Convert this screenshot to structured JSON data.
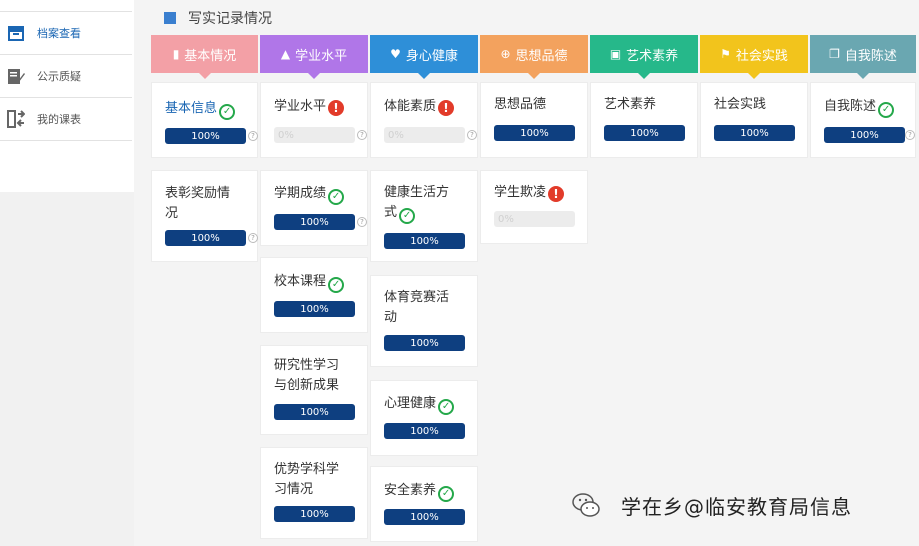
{
  "sidebar": {
    "items": [
      {
        "label": "档案查看",
        "icon": "archive-icon",
        "active": true
      },
      {
        "label": "公示质疑",
        "icon": "edit-icon",
        "active": false
      },
      {
        "label": "我的课表",
        "icon": "schedule-icon",
        "active": false
      }
    ]
  },
  "section": {
    "title": "写实记录情况"
  },
  "colors": {
    "basic": "#f3a0a6",
    "academic": "#b076e8",
    "health": "#2e8fd8",
    "moral": "#f3a25e",
    "art": "#26b88a",
    "social": "#f2c41c",
    "self": "#6aa7b1",
    "progress": "#0e3f80",
    "ok": "#24a84a",
    "warn": "#e23b2a",
    "link": "#1a66b3"
  },
  "tabs": [
    {
      "label": "基本情况",
      "icon": "document-icon"
    },
    {
      "label": "学业水平",
      "icon": "graduation-cap-icon"
    },
    {
      "label": "身心健康",
      "icon": "heart-icon"
    },
    {
      "label": "思想品德",
      "icon": "plus-circle-icon"
    },
    {
      "label": "艺术素养",
      "icon": "picture-icon"
    },
    {
      "label": "社会实践",
      "icon": "flag-icon"
    },
    {
      "label": "自我陈述",
      "icon": "copy-icon"
    }
  ],
  "cards": {
    "basic_info": {
      "title": "基本信息",
      "progress": "100%",
      "status": "ok"
    },
    "honors": {
      "title_line1": "表彰奖励情",
      "title_line2": "况",
      "progress": "100%"
    },
    "academic_level": {
      "title": "学业水平",
      "progress": "0%",
      "status": "warn"
    },
    "semester_grades": {
      "title": "学期成绩",
      "progress": "100%",
      "status": "ok"
    },
    "school_courses": {
      "title": "校本课程",
      "progress": "100%",
      "status": "ok"
    },
    "research": {
      "title_line1": "研究性学习",
      "title_line2": "与创新成果",
      "progress": "100%"
    },
    "strong_subjects": {
      "title_line1": "优势学科学",
      "title_line2": "习情况",
      "progress": "100%"
    },
    "fitness": {
      "title": "体能素质",
      "progress": "0%",
      "status": "warn"
    },
    "healthy_life": {
      "title_line1": "健康生活方",
      "title_line2": "式",
      "progress": "100%",
      "status": "ok"
    },
    "sports": {
      "title_line1": "体育竞赛活",
      "title_line2": "动",
      "progress": "100%"
    },
    "mental_health": {
      "title": "心理健康",
      "progress": "100%",
      "status": "ok"
    },
    "safety": {
      "title": "安全素养",
      "progress": "100%",
      "status": "ok"
    },
    "moral": {
      "title": "思想品德",
      "progress": "100%"
    },
    "bullying": {
      "title": "学生欺凌",
      "progress": "0%",
      "status": "warn"
    },
    "art": {
      "title": "艺术素养",
      "progress": "100%"
    },
    "social": {
      "title": "社会实践",
      "progress": "100%"
    },
    "self_statement": {
      "title": "自我陈述",
      "progress": "100%",
      "status": "ok"
    }
  },
  "help_mark": "?",
  "watermark": {
    "text": "学在乡@临安教育局信息",
    "icon": "wechat-icon"
  }
}
